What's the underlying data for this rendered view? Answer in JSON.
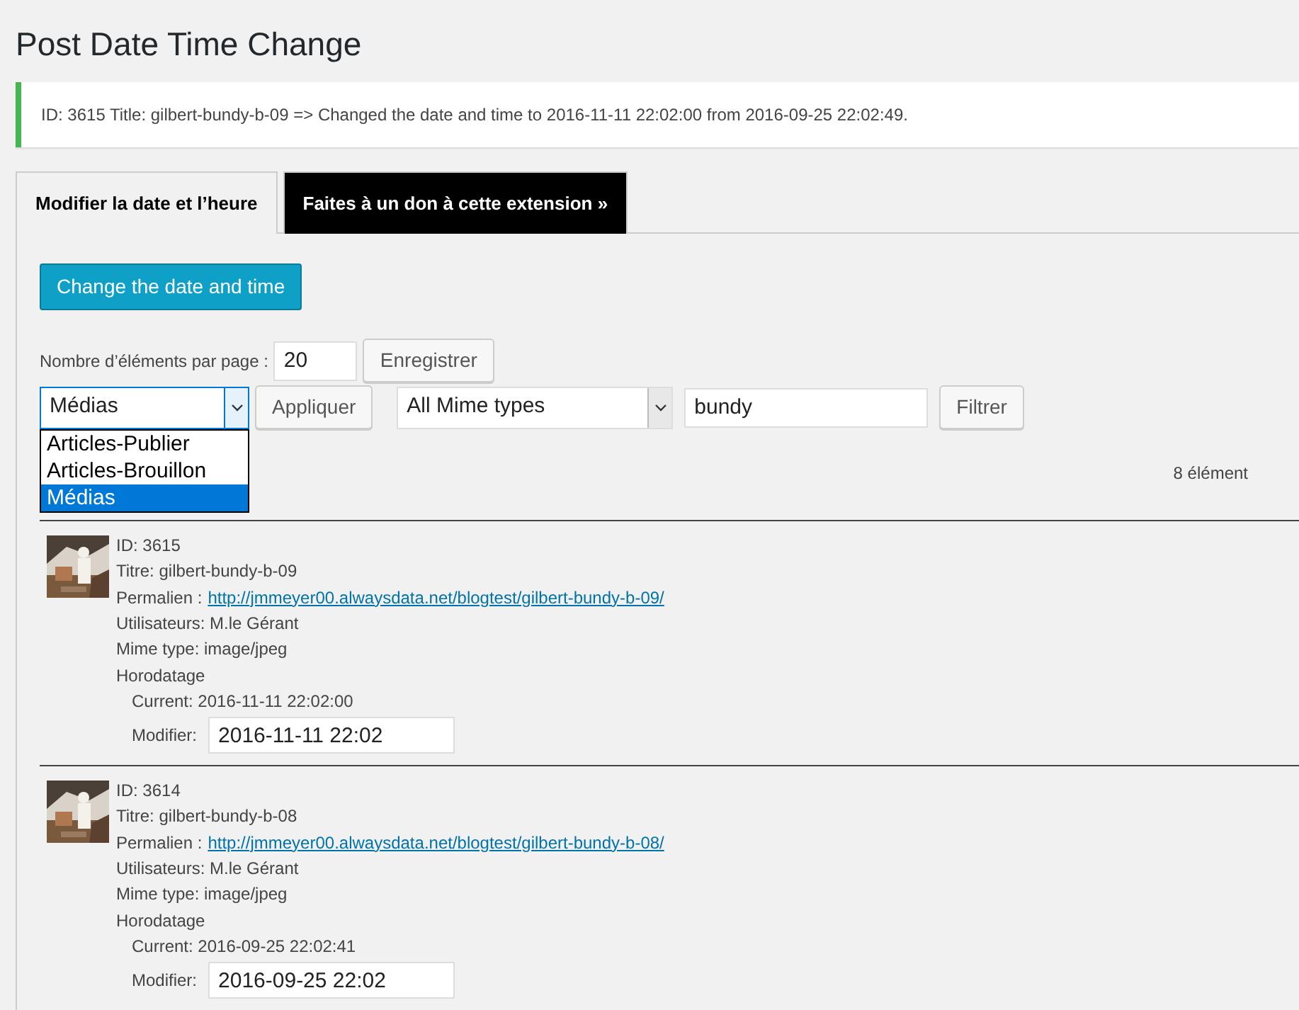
{
  "page_title": "Post Date Time Change",
  "notice": "ID: 3615 Title: gilbert-bundy-b-09 => Changed the date and time to 2016-11-11 22:02:00 from 2016-09-25 22:02:49.",
  "tabs": [
    {
      "label": "Modifier la date et l’heure",
      "selected": true
    },
    {
      "label": "Faites à un don à cette extension »",
      "selected": false
    }
  ],
  "change_button": "Change the date and time",
  "per_page": {
    "label": "Nombre d’éléments par page :",
    "value": "20",
    "button": "Enregistrer"
  },
  "type_select": {
    "value": "Médias",
    "expanded": true,
    "options": [
      {
        "label": "Articles-Publier",
        "selected": false
      },
      {
        "label": "Articles-Brouillon",
        "selected": false
      },
      {
        "label": "Médias",
        "selected": true
      }
    ]
  },
  "apply_button": "Appliquer",
  "mime_select": {
    "value": "All Mime types"
  },
  "search": {
    "value": "bundy"
  },
  "filter_button": "Filtrer",
  "count": "8 élément",
  "items": [
    {
      "kind": "picture",
      "id": "ID: 3615",
      "title": "Titre: gilbert-bundy-b-09",
      "permalink_label": "Permalien :",
      "permalink": "http://jmmeyer00.alwaysdata.net/blogtest/gilbert-bundy-b-09/",
      "user": "Utilisateurs: M.le Gérant",
      "mime": "Mime type: image/jpeg",
      "timestamp_label": "Horodatage",
      "current": "Current: 2016-11-11 22:02:00",
      "modify_label": "Modifier:",
      "modify_value": "2016-11-11 22:02"
    },
    {
      "kind": "picture",
      "id": "ID: 3614",
      "title": "Titre: gilbert-bundy-b-08",
      "permalink_label": "Permalien :",
      "permalink": "http://jmmeyer00.alwaysdata.net/blogtest/gilbert-bundy-b-08/",
      "user": "Utilisateurs: M.le Gérant",
      "mime": "Mime type: image/jpeg",
      "timestamp_label": "Horodatage",
      "current": "Current: 2016-09-25 22:02:41",
      "modify_label": "Modifier:",
      "modify_value": "2016-09-25 22:02"
    }
  ]
}
